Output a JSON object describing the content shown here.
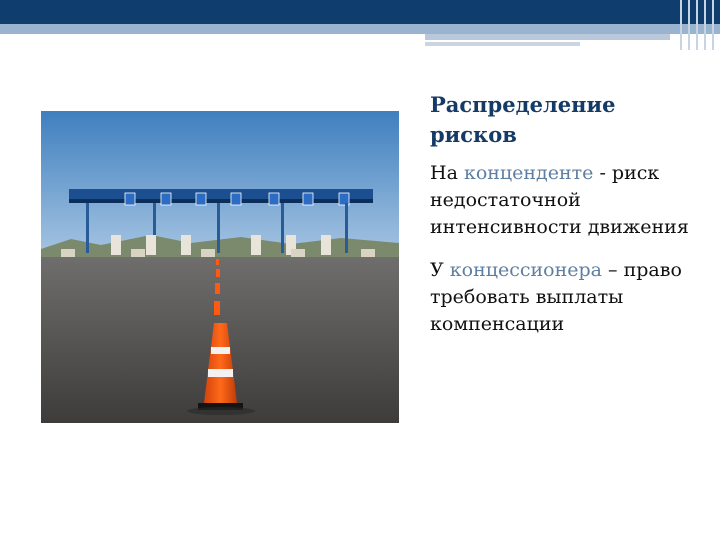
{
  "slide": {
    "heading": "Распределение рисков",
    "paragraphs": [
      {
        "pre": "На ",
        "highlight": "конценденте",
        "post": " - риск недостаточной интенсивности движения"
      },
      {
        "pre": "У ",
        "highlight": "концессионера",
        "post": " – право требовать выплаты компенсации"
      }
    ]
  },
  "colors": {
    "header_dark": "#0f3d6e",
    "header_light": "#9ab3cf",
    "heading_text": "#153a66",
    "highlight_text": "#5f7fa0"
  },
  "photo": {
    "subject": "toll-plaza-with-traffic-cone"
  }
}
